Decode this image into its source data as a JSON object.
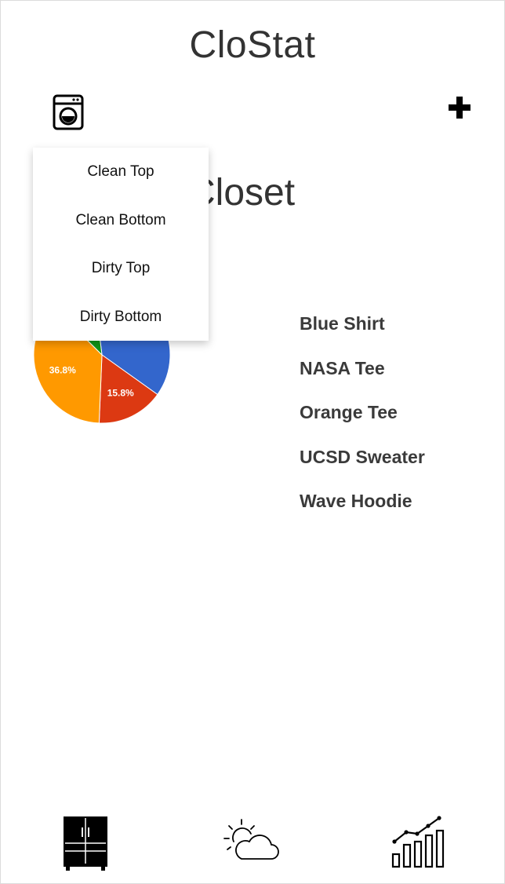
{
  "app": {
    "title": "CloStat"
  },
  "header": {
    "laundry_icon": "washing-machine-icon",
    "add_icon": "plus-icon"
  },
  "section": {
    "title": "Closet"
  },
  "dropdown": {
    "items": [
      {
        "label": "Clean Top"
      },
      {
        "label": "Clean Bottom"
      },
      {
        "label": "Dirty Top"
      },
      {
        "label": "Dirty Bottom"
      }
    ]
  },
  "closet": {
    "items": [
      {
        "label": "Blue Shirt"
      },
      {
        "label": "NASA Tee"
      },
      {
        "label": "Orange Tee"
      },
      {
        "label": "UCSD Sweater"
      },
      {
        "label": "Wave Hoodie"
      }
    ]
  },
  "chart_data": {
    "type": "pie",
    "slices": [
      {
        "label": "36.8%",
        "value": 36.8,
        "color": "#3366cc"
      },
      {
        "label": "15.8%",
        "value": 15.8,
        "color": "#dc3912"
      },
      {
        "label": "36.8%",
        "value": 36.8,
        "color": "#ff9900"
      },
      {
        "label": "",
        "value": 10.6,
        "color": "#109618"
      }
    ]
  },
  "bottom_nav": {
    "items": [
      {
        "icon": "closet-icon"
      },
      {
        "icon": "weather-icon"
      },
      {
        "icon": "stats-icon"
      }
    ]
  }
}
